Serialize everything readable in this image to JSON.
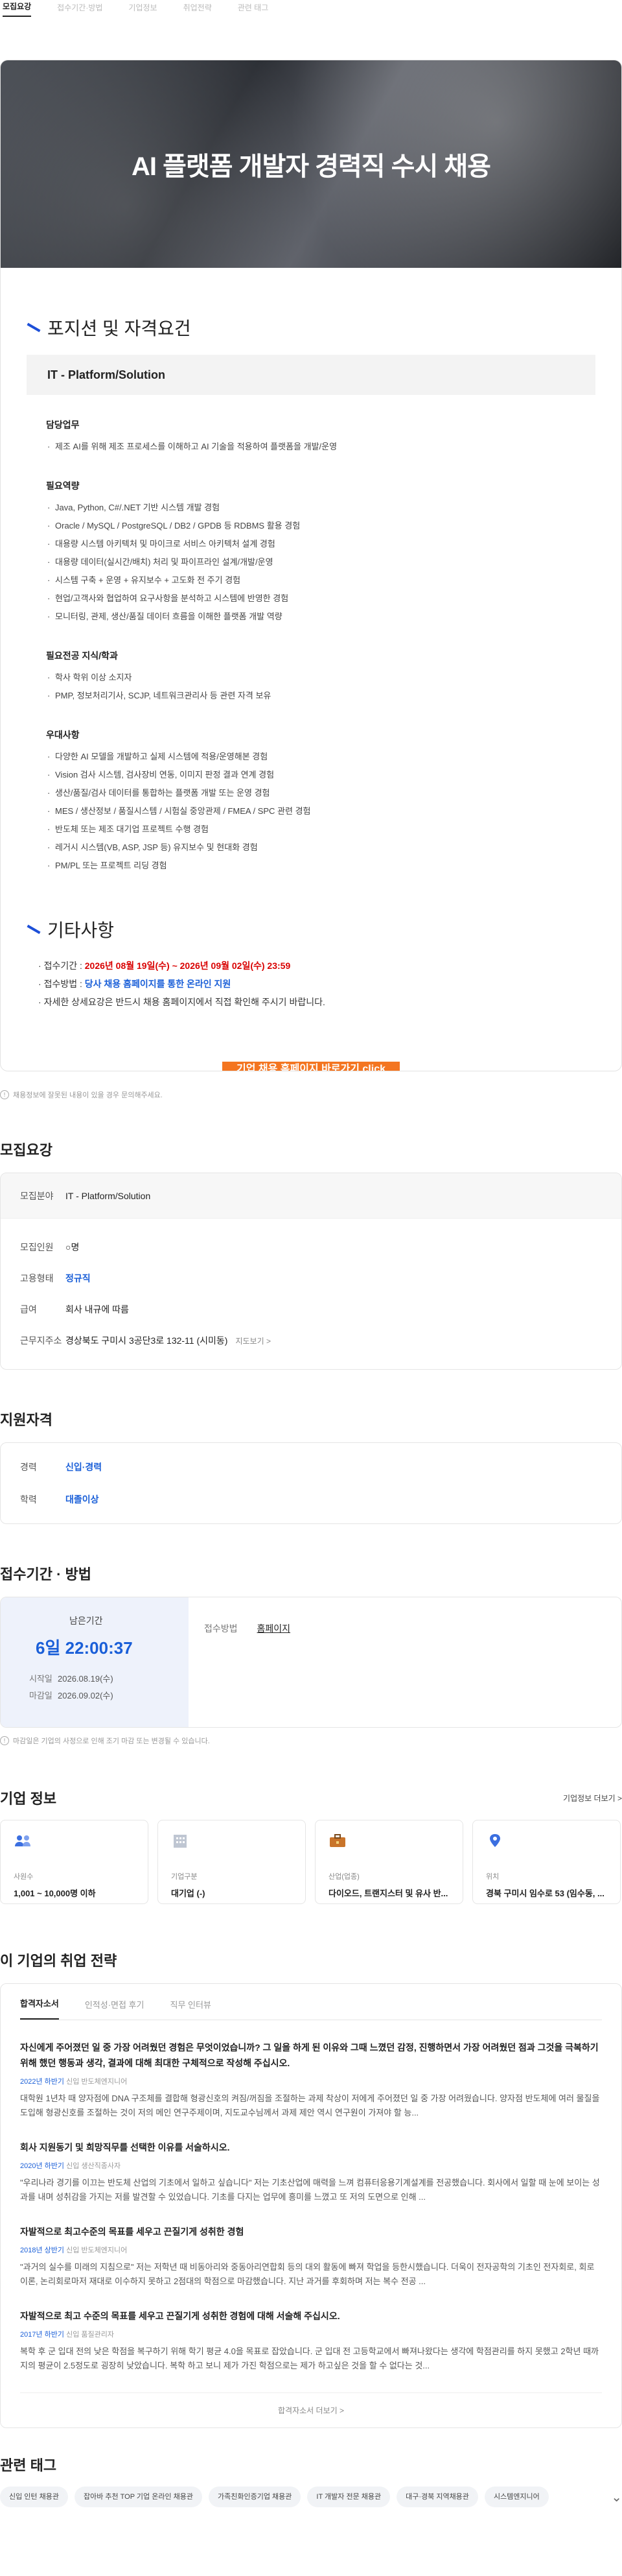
{
  "topnav": [
    "모집요강",
    "접수기간·방법",
    "기업정보",
    "취업전략",
    "관련 태그"
  ],
  "hero_title": "AI 플랫폼 개발자 경력직 수시 채용",
  "section1_title": "포지션 및 자격요건",
  "position_name": "IT - Platform/Solution",
  "groups": [
    {
      "title": "담당업무",
      "items": [
        "제조 AI를 위해 제조 프로세스를 이해하고 AI 기술을 적용하여 플랫폼을 개발/운영"
      ]
    },
    {
      "title": "필요역량",
      "items": [
        "Java, Python, C#/.NET 기반 시스템 개발 경험",
        "Oracle / MySQL / PostgreSQL / DB2 / GPDB 등 RDBMS 활용 경험",
        "대용량 시스템 아키텍처 및 마이크로 서비스 아키텍처 설계 경험",
        "대용량 데이터(실시간/배치) 처리 및 파이프라인 설계/개발/운영",
        "시스템 구축 + 운영 + 유지보수 + 고도화 전 주기 경험",
        "현업/고객사와 협업하여 요구사항을 분석하고 시스템에 반영한 경험",
        "모니터링, 관제, 생산/품질 데이터 흐름을 이해한 플랫폼 개발 역량"
      ]
    },
    {
      "title": "필요전공 지식/학과",
      "items": [
        "학사 학위 이상 소지자",
        "PMP, 정보처리기사, SCJP, 네트워크관리사 등 관련 자격 보유"
      ]
    },
    {
      "title": "우대사항",
      "items": [
        "다양한 AI 모델을 개발하고 실제 시스템에 적용/운영해본 경험",
        "Vision 검사 시스템, 검사장비 연동, 이미지 판정 결과 연계 경험",
        "생산/품질/검사 데이터를 통합하는 플랫폼 개발 또는 운영 경험",
        "MES / 생산정보 / 품질시스템 / 시험실 중앙관제 / FMEA / SPC 관련 경험",
        "반도체 또는 제조 대기업 프로젝트 수행 경험",
        "레거시 시스템(VB, ASP, JSP 등) 유지보수 및 현대화 경험",
        "PM/PL 또는 프로젝트 리딩 경험"
      ]
    }
  ],
  "section2_title": "기타사항",
  "etc": {
    "period_label": "접수기간 :",
    "period_value": "2026년 08월 19일(수) ~ 2026년 09월 02일(수) 23:59",
    "method_label": "접수방법 :",
    "method_value": "당사 채용 홈페이지를 통한 온라인 지원",
    "note": "자세한 상세요강은 반드시 채용 홈페이지에서 직접 확인해 주시기 바랍니다."
  },
  "cta_label": "기업 채용 홈페이지 바로가기 click",
  "poster_note": "채용정보에 잘못된 내용이 있을 경우 문의해주세요.",
  "req": {
    "title": "모집요강",
    "field_k": "모집분야",
    "field_v": "IT - Platform/Solution",
    "count_k": "모집인원",
    "count_v": "○명",
    "type_k": "고용형태",
    "type_v": "정규직",
    "pay_k": "급여",
    "pay_v": "회사 내규에 따름",
    "loc_k": "근무지주소",
    "loc_v": "경상북도 구미시 3공단3로 132-11 (시미동)",
    "loc_more": "지도보기 >"
  },
  "qual": {
    "title": "지원자격",
    "exp_k": "경력",
    "exp_v": "신입·경력",
    "edu_k": "학력",
    "edu_v": "대졸이상"
  },
  "deadline": {
    "title": "접수기간 · 방법",
    "remain_label": "남은기간",
    "remain_value": "6일 22:00:37",
    "start_k": "시작일",
    "start_v": "2026.08.19(수)",
    "end_k": "마감일",
    "end_v": "2026.09.02(수)",
    "method_k": "접수방법",
    "method_v": "홈페이지",
    "note": "마감일은 기업의 사정으로 인해 조기 마감 또는 변경될 수 있습니다."
  },
  "corp": {
    "title": "기업 정보",
    "more": "기업정보 더보기 >",
    "cards": [
      {
        "k": "사원수",
        "v": "1,001 ~ 10,000명 이하",
        "icon": "people-icon"
      },
      {
        "k": "기업구분",
        "v": "대기업 (-)",
        "icon": "building-icon"
      },
      {
        "k": "산업(업종)",
        "v": "다이오드, 트랜지스터 및 유사 반...",
        "icon": "briefcase-icon"
      },
      {
        "k": "위치",
        "v": "경북 구미시 임수로 53 (임수동, ...",
        "icon": "pin-icon"
      }
    ]
  },
  "strategy": {
    "title": "이 기업의 취업 전략",
    "tabs": [
      "합격자소서",
      "인적성·면접 후기",
      "직무 인터뷰"
    ],
    "items": [
      {
        "q": "자신에게 주어졌던 일 중 가장 어려웠던 경험은 무엇이었습니까? 그 일을 하게 된 이유와 그때 느꼈던 감정, 진행하면서 가장 어려웠던 점과 그것을 극복하기 위해 했던 행동과 생각, 결과에 대해 최대한 구체적으로 작성해 주십시오.",
        "year": "2022년 하반기",
        "kind": "신입",
        "job": "반도체엔지니어",
        "a": "대학원 1년차 때 양자점에 DNA 구조체를 결합해 형광신호의 켜짐/꺼짐을 조절하는 과제 착상이 저에게 주어졌던 일 중 가장 어려웠습니다. 양자점 반도체에 여러 물질을 도입해 형광신호를 조절하는 것이 저의 메인 연구주제이며, 지도교수님께서 과제 제안 역시 연구원이 가져야 할 능..."
      },
      {
        "q": "회사 지원동기 및 희망직무를 선택한 이유를 서술하시오.",
        "year": "2020년 하반기",
        "kind": "신입",
        "job": "생산직종사자",
        "a": "\"우리나라 경기를 이끄는 반도체 산업의 기초에서 일하고 싶습니다\" 저는 기초산업에 매력을 느껴 컴퓨터응용기계설계를 전공했습니다. 회사에서 일할 때 눈에 보이는 성과를 내며 성취감을 가지는 저를 발견할 수 있었습니다. 기초를 다지는 업무에 흥미를 느꼈고 또 저의 도면으로 인해 ..."
      },
      {
        "q": "자발적으로 최고수준의 목표를 세우고 끈질기게 성취한 경험",
        "year": "2018년 상반기",
        "kind": "신입",
        "job": "반도체엔지니어",
        "a": "\"과거의 실수를 미래의 지침으로\" 저는 저학년 때 비동아리와 중동아리연합회 등의 대외 활동에 빠져 학업을 등한시했습니다. 더욱이 전자공학의 기초인 전자회로, 회로이론, 논리회로마저 재대로 이수하지 못하고 2점대의 학점으로 마감했습니다. 지난 과거를 후회하며 저는 복수 전공 ..."
      },
      {
        "q": "자발적으로 최고 수준의 목표를 세우고 끈질기게 성취한 경험에 대해 서술해 주십시오.",
        "year": "2017년 하반기",
        "kind": "신입",
        "job": "품질관리자",
        "a": "복학 후 군 입대 전의 낮은 학점을 복구하기 위해 학기 평균 4.0을 목표로 잡았습니다. 군 입대 전 고등학교에서 빠져나왔다는 생각에 학점관리를 하지 못했고 2학년 때까지의 평균이 2.5정도로 굉장히 낮았습니다. 복학 하고 보니 제가 가진 학점으로는 제가 하고싶은 것을 할 수 없다는 것..."
      }
    ],
    "more": "합격자소서 더보기 >"
  },
  "tags": {
    "title": "관련 태그",
    "items": [
      "신입 인턴 채용관",
      "잡아바 추천 TOP 기업 온라인 채용관",
      "가족친화인증기업 채용관",
      "IT 개발자 전문 채용관",
      "대구·경북 지역채용관",
      "시스템엔지니어"
    ]
  }
}
